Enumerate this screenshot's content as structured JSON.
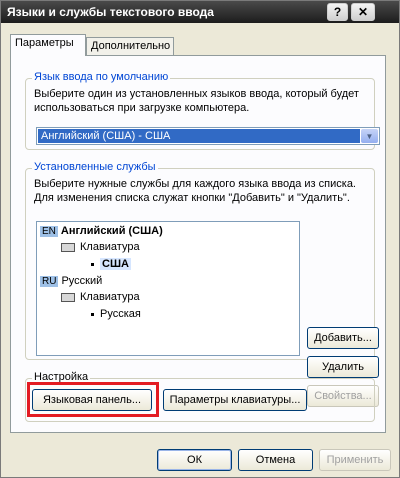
{
  "window": {
    "title": "Языки и службы текстового ввода"
  },
  "titlebar_buttons": {
    "help": "?",
    "close": "✕"
  },
  "tabs": [
    {
      "label": "Параметры"
    },
    {
      "label": "Дополнительно"
    }
  ],
  "default_language": {
    "legend": "Язык ввода по умолчанию",
    "description_line1": "Выберите один из установленных языков ввода, который будет",
    "description_line2": "использоваться при загрузке компьютера.",
    "selected": "Английский (США) - США"
  },
  "installed_services": {
    "legend": "Установленные службы",
    "description_line1": "Выберите нужные службы для каждого языка ввода из списка.",
    "description_line2": "Для изменения списка служат кнопки \"Добавить\" и \"Удалить\".",
    "tree": {
      "en_code": "EN",
      "en_label": "Английский (США)",
      "en_keyboard": "Клавиатура",
      "en_layout": "США",
      "ru_code": "RU",
      "ru_label": "Русский",
      "ru_keyboard": "Клавиатура",
      "ru_layout": "Русская"
    },
    "buttons": {
      "add": "Добавить...",
      "remove": "Удалить",
      "properties": "Свойства..."
    }
  },
  "settings": {
    "legend": "Настройка",
    "language_bar_button": "Языковая панель...",
    "keyboard_settings_button": "Параметры клавиатуры..."
  },
  "footer": {
    "ok": "ОК",
    "cancel": "Отмена",
    "apply": "Применить"
  },
  "colors": {
    "highlight_frame": "#e31b23",
    "selection": "#316ac5",
    "group_legend": "#0046d5"
  }
}
